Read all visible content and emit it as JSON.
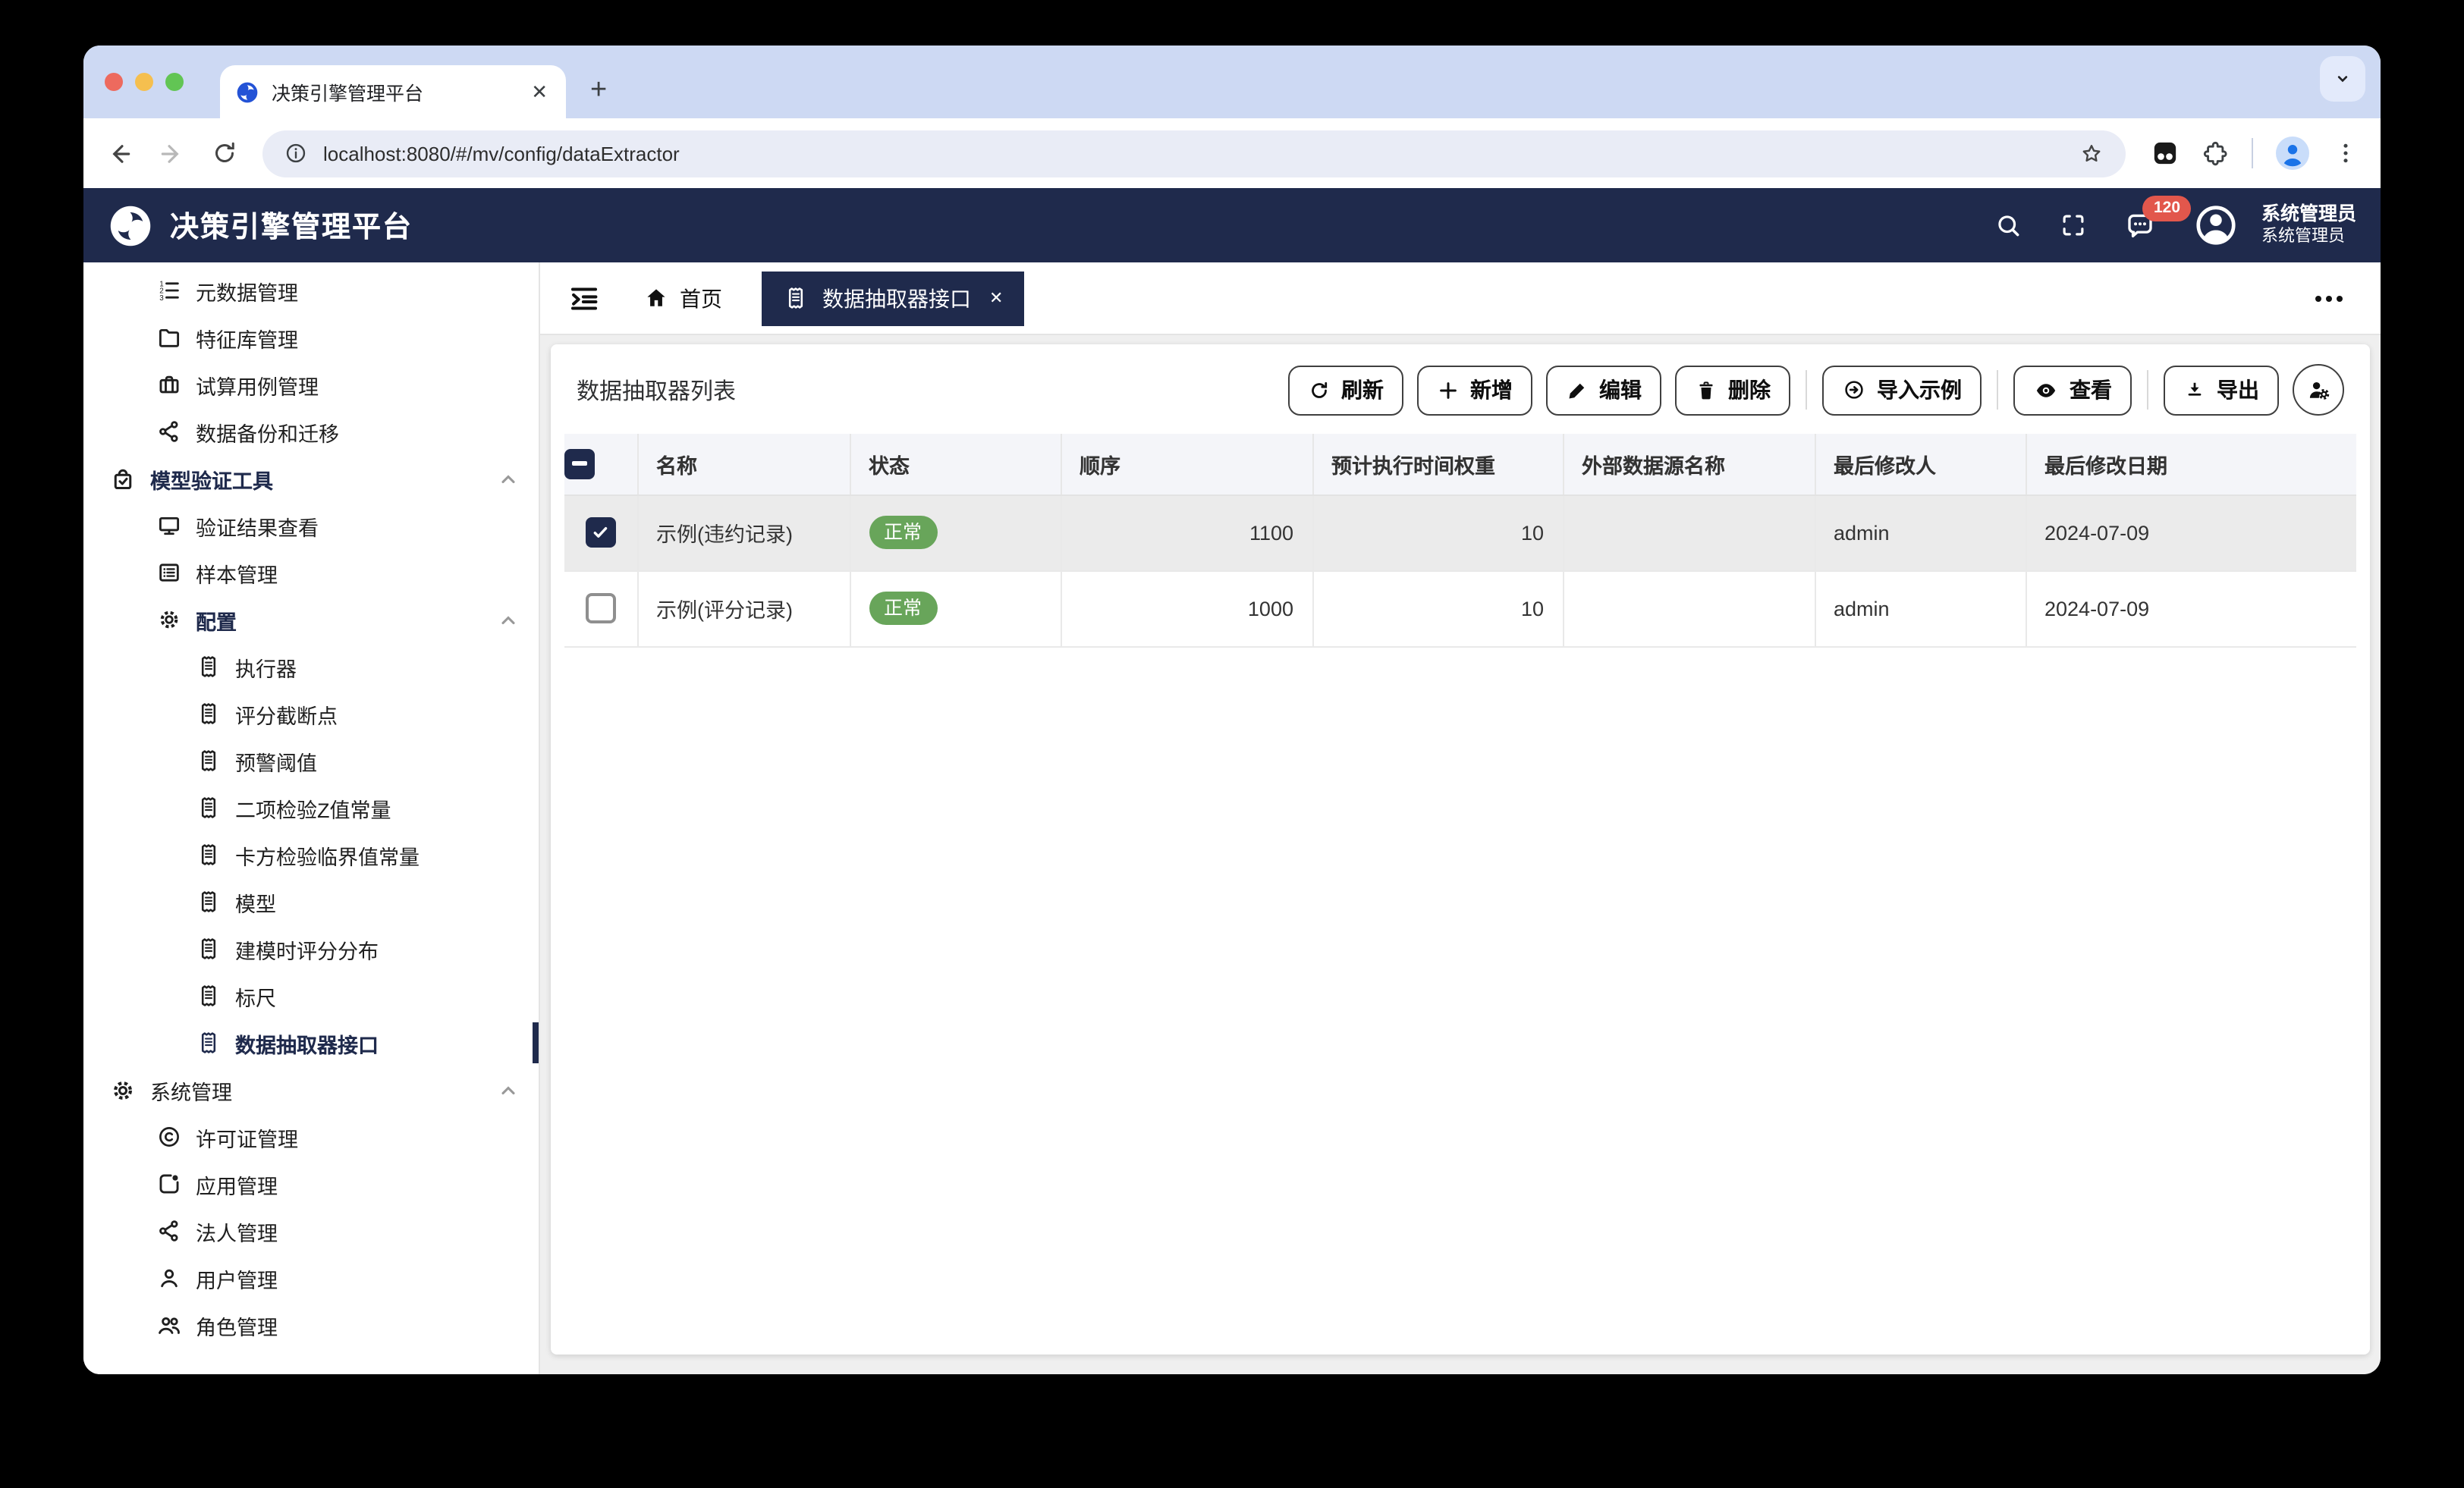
{
  "browser": {
    "tab_title": "决策引擎管理平台",
    "url": "localhost:8080/#/mv/config/dataExtractor"
  },
  "app_header": {
    "title": "决策引擎管理平台",
    "badge_count": "120",
    "user_name": "系统管理员",
    "user_role": "系统管理员"
  },
  "nav_tabs": {
    "home_label": "首页",
    "active_tab_label": "数据抽取器接口"
  },
  "sidebar": {
    "items": [
      {
        "label": "元数据管理",
        "icon": "ordered-list",
        "level": 2
      },
      {
        "label": "特征库管理",
        "icon": "folder",
        "level": 2
      },
      {
        "label": "试算用例管理",
        "icon": "briefcase",
        "level": 2
      },
      {
        "label": "数据备份和迁移",
        "icon": "share-nodes",
        "level": 2
      },
      {
        "label": "模型验证工具",
        "icon": "bag-check",
        "level": 1,
        "group": true,
        "expanded": true,
        "active_path": true
      },
      {
        "label": "验证结果查看",
        "icon": "monitor",
        "level": 2
      },
      {
        "label": "样本管理",
        "icon": "list-box",
        "level": 2
      },
      {
        "label": "配置",
        "icon": "gear",
        "level": 2,
        "group": true,
        "expanded": true,
        "active_path": true
      },
      {
        "label": "执行器",
        "icon": "receipt",
        "level": 3
      },
      {
        "label": "评分截断点",
        "icon": "receipt",
        "level": 3
      },
      {
        "label": "预警阈值",
        "icon": "receipt",
        "level": 3
      },
      {
        "label": "二项检验Z值常量",
        "icon": "receipt",
        "level": 3
      },
      {
        "label": "卡方检验临界值常量",
        "icon": "receipt",
        "level": 3
      },
      {
        "label": "模型",
        "icon": "receipt",
        "level": 3
      },
      {
        "label": "建模时评分分布",
        "icon": "receipt",
        "level": 3
      },
      {
        "label": "标尺",
        "icon": "receipt",
        "level": 3
      },
      {
        "label": "数据抽取器接口",
        "icon": "receipt",
        "level": 3,
        "selected": true
      },
      {
        "label": "系统管理",
        "icon": "gear",
        "level": 1,
        "group": true,
        "expanded": true
      },
      {
        "label": "许可证管理",
        "icon": "copyright",
        "level": 2
      },
      {
        "label": "应用管理",
        "icon": "app-window",
        "level": 2
      },
      {
        "label": "法人管理",
        "icon": "share-nodes",
        "level": 2
      },
      {
        "label": "用户管理",
        "icon": "user",
        "level": 2
      },
      {
        "label": "角色管理",
        "icon": "users",
        "level": 2
      }
    ]
  },
  "page": {
    "list_title": "数据抽取器列表",
    "toolbar": {
      "refresh": "刷新",
      "add": "新增",
      "edit": "编辑",
      "delete": "删除",
      "import_sample": "导入示例",
      "view": "查看",
      "export": "导出"
    },
    "table": {
      "headers": [
        "名称",
        "状态",
        "顺序",
        "预计执行时间权重",
        "外部数据源名称",
        "最后修改人",
        "最后修改日期"
      ],
      "rows": [
        {
          "checked": true,
          "name": "示例(违约记录)",
          "status": "正常",
          "order": "1100",
          "weight": "10",
          "ext_source": "",
          "modified_by": "admin",
          "modified_date": "2024-07-09"
        },
        {
          "checked": false,
          "name": "示例(评分记录)",
          "status": "正常",
          "order": "1000",
          "weight": "10",
          "ext_source": "",
          "modified_by": "admin",
          "modified_date": "2024-07-09"
        }
      ]
    }
  },
  "colors": {
    "navy": "#1f2a4c",
    "status_green": "#68a55a",
    "badge_red": "#e2574c",
    "tabstrip_blue": "#cdd9f3",
    "selected_row_gray": "#ebebeb"
  }
}
